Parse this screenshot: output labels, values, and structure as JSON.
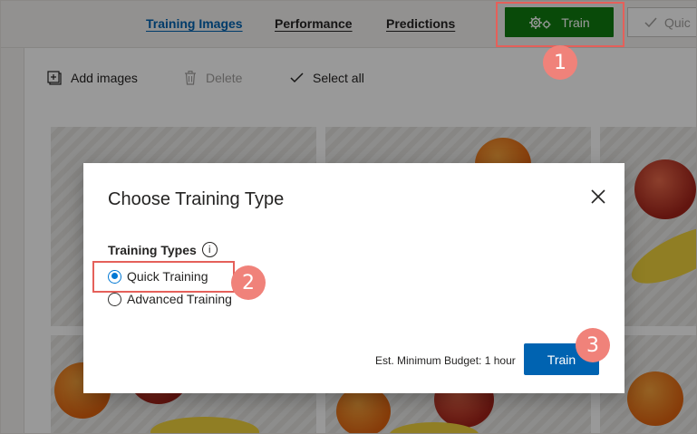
{
  "nav": {
    "tabs": [
      {
        "label": "Training Images",
        "active": true
      },
      {
        "label": "Performance",
        "active": false
      },
      {
        "label": "Predictions",
        "active": false
      }
    ],
    "train_label": "Train",
    "quick_label": "Quic"
  },
  "toolbar": {
    "add_images": "Add images",
    "delete": "Delete",
    "select_all": "Select all"
  },
  "dialog": {
    "title": "Choose Training Type",
    "types_label": "Training Types",
    "options": [
      {
        "label": "Quick Training",
        "selected": true
      },
      {
        "label": "Advanced Training",
        "selected": false
      }
    ],
    "budget": "Est. Minimum Budget: 1 hour",
    "train_button": "Train"
  },
  "callouts": [
    "1",
    "2",
    "3"
  ],
  "colors": {
    "train_green": "#107c10",
    "primary_blue": "#0063b1",
    "callout": "#f0827a",
    "highlight_border": "#e5605a"
  }
}
